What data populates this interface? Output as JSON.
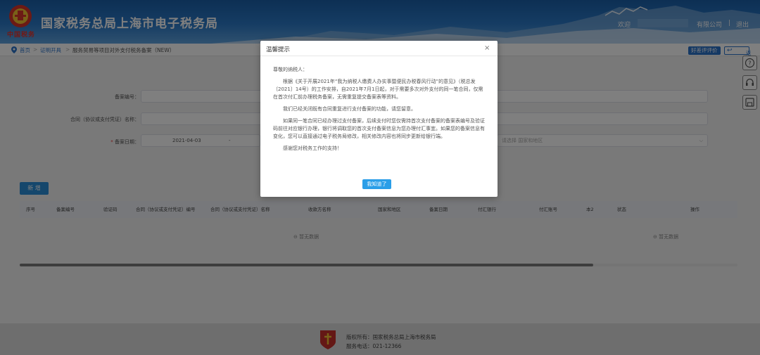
{
  "header": {
    "title": "国家税务总局上海市电子税务局",
    "brand_script": "中国税务",
    "welcome": "欢迎",
    "company": "有限公司",
    "separator": "|",
    "logout": "退出"
  },
  "breadcrumb": {
    "home": "首页",
    "sep": ">",
    "cert": "证明开具",
    "page": "服务贸易等项目对外支付税务备案（NEW）",
    "rate": "好差评评价",
    "back": "返回"
  },
  "form": {
    "record_no_label": "备案编号：",
    "contract_name_label": "合同（协议或支付凭证）名称：",
    "record_date_label": "备案日期：",
    "required_mark": "*",
    "date_start": "2021-04-03",
    "date_sep": "-",
    "region_placeholder": "请选择 国家和地区"
  },
  "add_button": "新 增",
  "table": {
    "columns": [
      "序号",
      "备案编号",
      "验证码",
      "合同（协议或支付凭证）编号",
      "合同（协议或支付凭证）名称",
      "收款方名称",
      "国家和地区",
      "备案日期",
      "付汇银行",
      "付汇账号",
      "本2",
      "状态",
      "操作"
    ],
    "empty_text": "暂无数据",
    "empty_text_right": "暂无数据"
  },
  "footer": {
    "copyright": "版权所有：国家税务总局上海市税务局",
    "phone": "服务电话：021-12366"
  },
  "modal": {
    "title": "温馨提示",
    "close": "×",
    "greeting": "尊敬的纳税人：",
    "para1": "根据《关于开展2021年“我为纳税人缴费人办实事暨便民办税春风行动”的意见》（税总发〔2021〕14号）的工作安排，自2021年7月1日起，对于需要多次对外支付的同一笔合同，仅需在首次付汇前办理税务备案，无需重复提交备案表等资料。",
    "para2": "我们已经关闭既有合同重复进行支付备案的功能，请您留意。",
    "para3": "如果同一笔合同已经办理过支付备案，后续支付时您仅需持首次支付备案的备案表编号及验证码前往对应银行办理，银行将调取您的首次支付备案信息为您办理付汇事宜。如果您的备案信息有变化，您可以直接通过电子税务局修改，相关修改内容也将同步更新给银行端。",
    "para4": "感谢您对税务工作的支持！",
    "ok": "我知道了"
  },
  "colors": {
    "header_blue": "#2b79c7",
    "accent_blue": "#2a8fd8",
    "brand_red": "#e6322a"
  }
}
